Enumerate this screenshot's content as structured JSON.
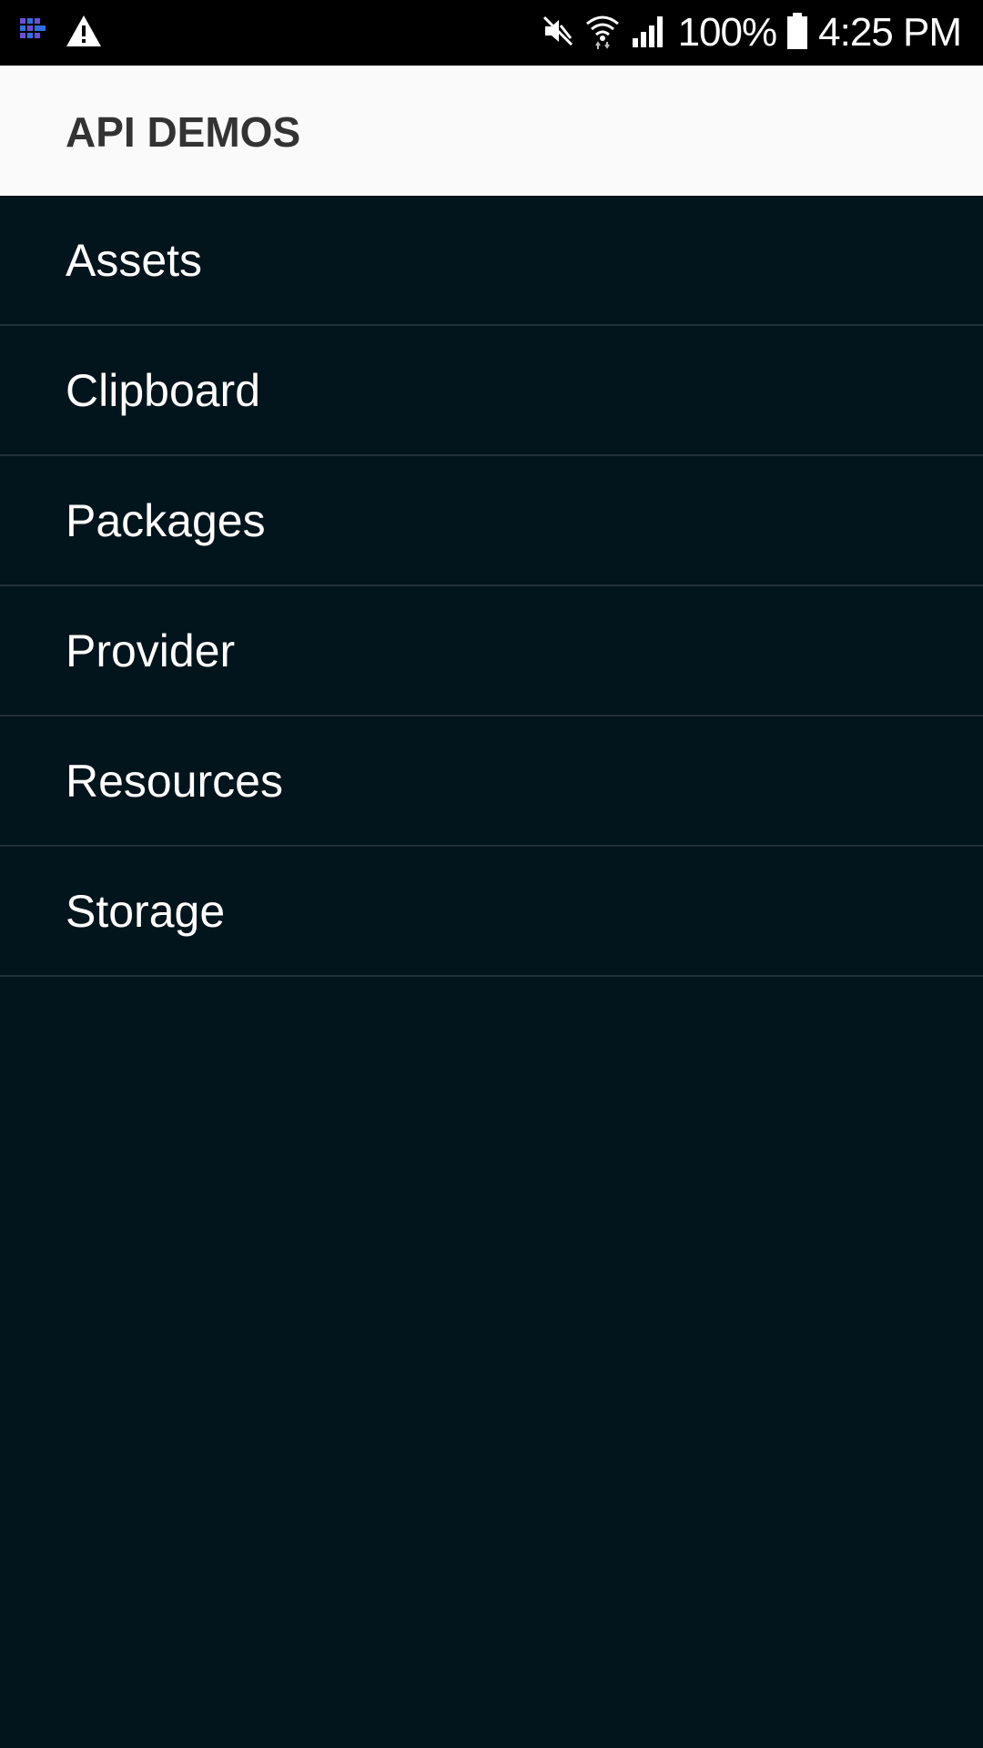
{
  "status_bar": {
    "left_icons": [
      "app-grid-icon",
      "warning-icon"
    ],
    "right_icons": [
      "mute-icon",
      "wifi-icon",
      "signal-icon",
      "battery-icon"
    ],
    "battery": "100%",
    "time": "4:25 PM"
  },
  "app_bar": {
    "title": "API DEMOS"
  },
  "list": {
    "items": [
      {
        "label": "Assets"
      },
      {
        "label": "Clipboard"
      },
      {
        "label": "Packages"
      },
      {
        "label": "Provider"
      },
      {
        "label": "Resources"
      },
      {
        "label": "Storage"
      }
    ]
  },
  "colors": {
    "background": "#02141c",
    "app_bar": "#fafafa",
    "divider": "#223038",
    "title_text": "#333333",
    "item_text": "#ffffff"
  }
}
